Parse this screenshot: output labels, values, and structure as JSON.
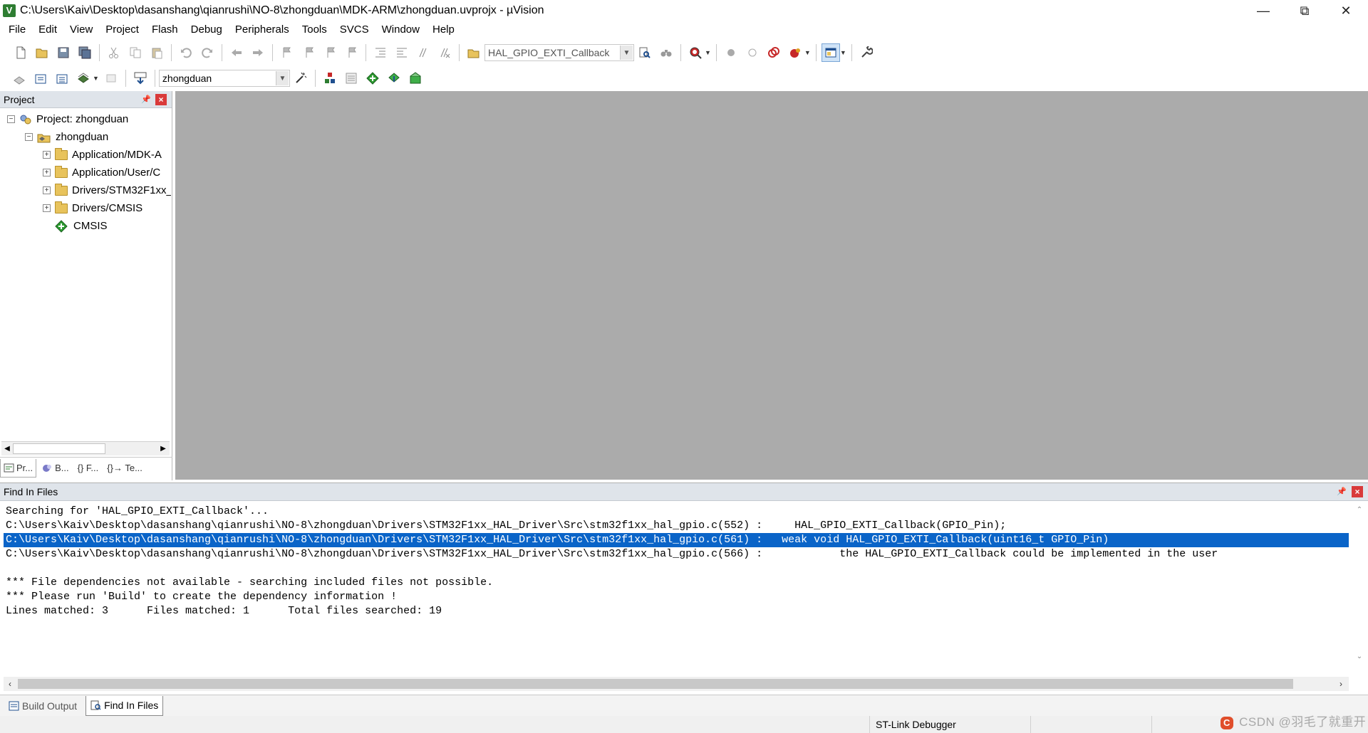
{
  "window": {
    "title": "C:\\Users\\Kaiv\\Desktop\\dasanshang\\qianrushi\\NO-8\\zhongduan\\MDK-ARM\\zhongduan.uvprojx - µVision",
    "minimize": "—",
    "restore": "⧉",
    "close": "✕"
  },
  "menu": [
    "File",
    "Edit",
    "View",
    "Project",
    "Flash",
    "Debug",
    "Peripherals",
    "Tools",
    "SVCS",
    "Window",
    "Help"
  ],
  "toolbar1": {
    "find_combo_value": "HAL_GPIO_EXTI_Callback"
  },
  "toolbar2": {
    "target_combo_value": "zhongduan",
    "load_label": "LOAD"
  },
  "project_panel": {
    "title": "Project",
    "tree": [
      {
        "label": "Project: zhongduan",
        "level": 0,
        "expander": "−"
      },
      {
        "label": "zhongduan",
        "level": 1,
        "expander": "−"
      },
      {
        "label": "Application/MDK-A",
        "level": 2,
        "expander": "+"
      },
      {
        "label": "Application/User/C",
        "level": 2,
        "expander": "+"
      },
      {
        "label": "Drivers/STM32F1xx_",
        "level": 2,
        "expander": "+"
      },
      {
        "label": "Drivers/CMSIS",
        "level": 2,
        "expander": "+"
      },
      {
        "label": "CMSIS",
        "level": 2,
        "expander": ""
      }
    ],
    "tabs": [
      "Pr...",
      "B...",
      "{} F...",
      "{}→ Te..."
    ]
  },
  "find_panel": {
    "title": "Find In Files",
    "lines": [
      "Searching for 'HAL_GPIO_EXTI_Callback'...",
      "C:\\Users\\Kaiv\\Desktop\\dasanshang\\qianrushi\\NO-8\\zhongduan\\Drivers\\STM32F1xx_HAL_Driver\\Src\\stm32f1xx_hal_gpio.c(552) :     HAL_GPIO_EXTI_Callback(GPIO_Pin);",
      "C:\\Users\\Kaiv\\Desktop\\dasanshang\\qianrushi\\NO-8\\zhongduan\\Drivers\\STM32F1xx_HAL_Driver\\Src\\stm32f1xx_hal_gpio.c(561) :   weak void HAL_GPIO_EXTI_Callback(uint16_t GPIO_Pin)",
      "C:\\Users\\Kaiv\\Desktop\\dasanshang\\qianrushi\\NO-8\\zhongduan\\Drivers\\STM32F1xx_HAL_Driver\\Src\\stm32f1xx_hal_gpio.c(566) :            the HAL_GPIO_EXTI_Callback could be implemented in the user",
      "",
      "*** File dependencies not available - searching included files not possible.",
      "*** Please run 'Build' to create the dependency information !",
      "Lines matched: 3      Files matched: 1      Total files searched: 19"
    ],
    "selected_line": 2
  },
  "bottom_tabs": [
    "Build Output",
    "Find In Files"
  ],
  "active_bottom_tab": "Find In Files",
  "status": {
    "debugger": "ST-Link Debugger"
  },
  "watermark": {
    "badge": "C",
    "text": "CSDN @羽毛了就重开"
  },
  "colors": {
    "selection": "#0a64c8",
    "editor_bg": "#ababab",
    "panel_header": "#dfe4ea",
    "close_red": "#d93a3a"
  }
}
